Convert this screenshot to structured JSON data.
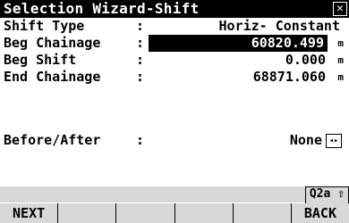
{
  "title": "Selection Wizard-Shift",
  "close_icon": "close-icon",
  "fields": [
    {
      "label": "Shift Type",
      "value": "Horiz- Constant",
      "unit": ""
    },
    {
      "label": "Beg Chainage",
      "value": "60820.499",
      "unit": "m"
    },
    {
      "label": "Beg Shift",
      "value": "0.000",
      "unit": "m"
    },
    {
      "label": "End Chainage",
      "value": "68871.060",
      "unit": "m"
    }
  ],
  "before_after": {
    "label": "Before/After",
    "value": "None",
    "icon": "spin-arrows-icon"
  },
  "status_badge": "Q2a ⇧",
  "softkeys": [
    "NEXT",
    "",
    "",
    "",
    "",
    "BACK"
  ]
}
